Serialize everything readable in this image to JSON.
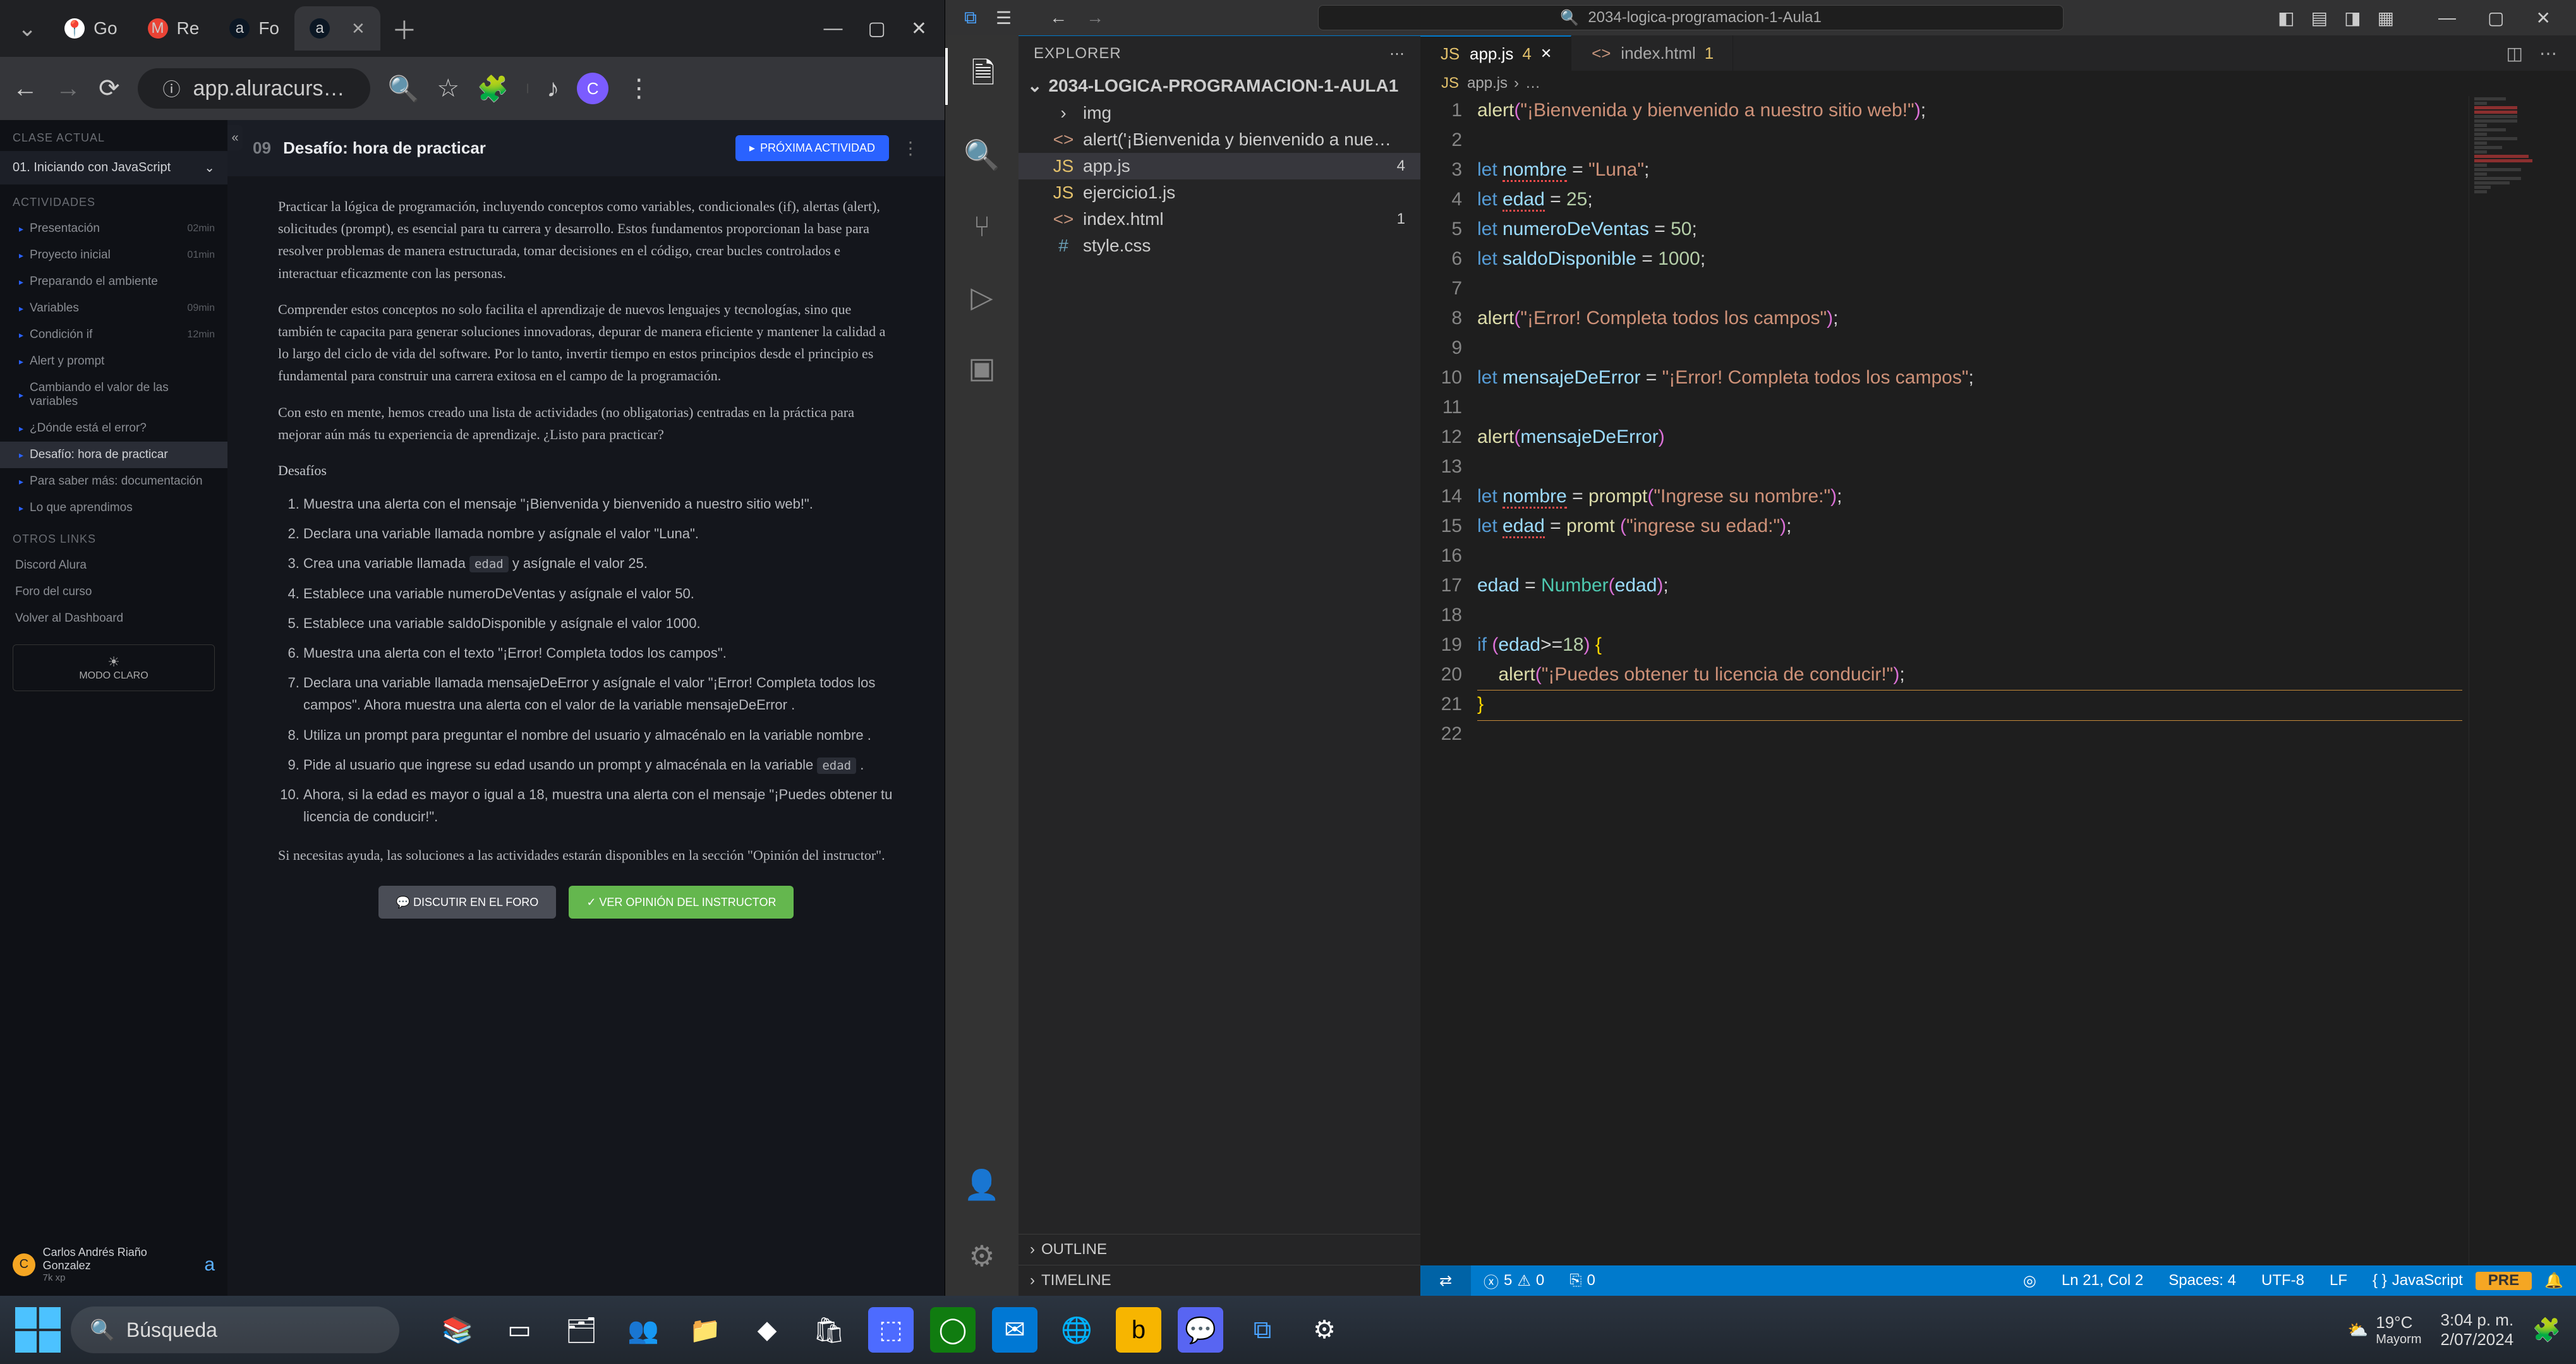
{
  "chrome": {
    "tabs": [
      {
        "label": "Go",
        "favicon": "📍",
        "fav_bg": "#fff"
      },
      {
        "label": "Re",
        "favicon": "M",
        "fav_bg": "#ea4335"
      },
      {
        "label": "Fo",
        "favicon": "a",
        "fav_bg": "#0b1724"
      },
      {
        "label": "",
        "favicon": "a",
        "fav_bg": "#0b1724",
        "active": true
      }
    ],
    "url": "app.aluracurs…"
  },
  "alura": {
    "section_class": "CLASE ACTUAL",
    "module": "01. Iniciando con JavaScript",
    "section_activities": "ACTIVIDADES",
    "items": [
      {
        "label": "Presentación",
        "dur": "02min"
      },
      {
        "label": "Proyecto inicial",
        "dur": "01min"
      },
      {
        "label": "Preparando el ambiente",
        "dur": ""
      },
      {
        "label": "Variables",
        "dur": "09min"
      },
      {
        "label": "Condición if",
        "dur": "12min"
      },
      {
        "label": "Alert y prompt",
        "dur": ""
      },
      {
        "label": "Cambiando el valor de las variables",
        "dur": ""
      },
      {
        "label": "¿Dónde está el error?",
        "dur": ""
      },
      {
        "label": "Desafío: hora de practicar",
        "dur": "",
        "active": true
      },
      {
        "label": "Para saber más: documentación",
        "dur": ""
      },
      {
        "label": "Lo que aprendimos",
        "dur": ""
      }
    ],
    "section_links": "OTROS LINKS",
    "links": [
      "Discord Alura",
      "Foro del curso",
      "Volver al Dashboard"
    ],
    "modo": "MODO CLARO",
    "user": {
      "name": "Carlos Andrés Riaño Gonzalez",
      "xp": "7k xp",
      "initial": "C"
    },
    "header": {
      "num": "09",
      "title": "Desafío: hora de practicar",
      "next": "PRÓXIMA ACTIVIDAD"
    },
    "paras": [
      "Practicar la lógica de programación, incluyendo conceptos como variables, condicionales (if), alertas (alert), solicitudes (prompt), es esencial para tu carrera y desarrollo. Estos fundamentos proporcionan la base para resolver problemas de manera estructurada, tomar decisiones en el código, crear bucles controlados e interactuar eficazmente con las personas.",
      "Comprender estos conceptos no solo facilita el aprendizaje de nuevos lenguajes y tecnologías, sino que también te capacita para generar soluciones innovadoras, depurar de manera eficiente y mantener la calidad a lo largo del ciclo de vida del software. Por lo tanto, invertir tiempo en estos principios desde el principio es fundamental para construir una carrera exitosa en el campo de la programación.",
      "Con esto en mente, hemos creado una lista de actividades (no obligatorias) centradas en la práctica para mejorar aún más tu experiencia de aprendizaje. ¿Listo para practicar?"
    ],
    "subhead": "Desafíos",
    "tasks": [
      "Muestra una alerta con el mensaje \"¡Bienvenida y bienvenido a nuestro sitio web!\".",
      "Declara una variable llamada nombre y asígnale el valor \"Luna\".",
      "Crea una variable llamada |edad| y asígnale el valor 25.",
      "Establece una variable numeroDeVentas y asígnale el valor 50.",
      "Establece una variable saldoDisponible y asígnale el valor 1000.",
      "Muestra una alerta con el texto \"¡Error! Completa todos los campos\".",
      "Declara una variable llamada mensajeDeError y asígnale el valor \"¡Error! Completa todos los campos\". Ahora muestra una alerta con el valor de la variable mensajeDeError .",
      "Utiliza un prompt para preguntar el nombre del usuario y almacénalo en la variable nombre .",
      "Pide al usuario que ingrese su edad usando un prompt y almacénala en la variable |edad| .",
      "Ahora, si la edad es mayor o igual a 18, muestra una alerta con el mensaje \"¡Puedes obtener tu licencia de conducir!\"."
    ],
    "help": "Si necesitas ayuda, las soluciones a las actividades estarán disponibles en la sección \"Opinión del instructor\".",
    "btn_forum": "DISCUTIR EN EL FORO",
    "btn_opinion": "VER OPINIÓN DEL INSTRUCTOR"
  },
  "vscode": {
    "project": "2034-logica-programacion-1-Aula1",
    "explorer_label": "EXPLORER",
    "folder": "2034-LOGICA-PROGRAMACION-1-AULA1",
    "tree": [
      {
        "icon": "›",
        "type": "folder",
        "name": "img"
      },
      {
        "icon": "<>",
        "type": "html",
        "name": "alert('¡Bienvenida y bienvenido a nue…"
      },
      {
        "icon": "JS",
        "type": "js",
        "name": "app.js",
        "badge": "4",
        "active": true
      },
      {
        "icon": "JS",
        "type": "js",
        "name": "ejercicio1.js"
      },
      {
        "icon": "<>",
        "type": "html",
        "name": "index.html",
        "badge": "1"
      },
      {
        "icon": "#",
        "type": "css",
        "name": "style.css"
      }
    ],
    "outline": "OUTLINE",
    "timeline": "TIMELINE",
    "tabs": [
      {
        "icon": "JS",
        "name": "app.js",
        "mod": "4",
        "active": true,
        "closable": true
      },
      {
        "icon": "<>",
        "name": "index.html",
        "mod": "1"
      }
    ],
    "breadcrumb": [
      "JS",
      "app.js",
      "›",
      "…"
    ],
    "code": [
      [
        [
          "fn",
          "alert"
        ],
        [
          "paren",
          "("
        ],
        [
          "str",
          "\"¡Bienvenida y bienvenido a nuestro sitio web!\""
        ],
        [
          "paren",
          ")"
        ],
        [
          "op",
          ";"
        ]
      ],
      [],
      [
        [
          "kw",
          "let"
        ],
        [
          "sp",
          " "
        ],
        [
          "var",
          "nombre",
          true
        ],
        [
          "sp",
          " "
        ],
        [
          "op",
          "="
        ],
        [
          "sp",
          " "
        ],
        [
          "str",
          "\"Luna\""
        ],
        [
          "op",
          ";"
        ]
      ],
      [
        [
          "kw",
          "let"
        ],
        [
          "sp",
          " "
        ],
        [
          "var",
          "edad",
          true
        ],
        [
          "sp",
          " "
        ],
        [
          "op",
          "="
        ],
        [
          "sp",
          " "
        ],
        [
          "num",
          "25"
        ],
        [
          "op",
          ";"
        ]
      ],
      [
        [
          "kw",
          "let"
        ],
        [
          "sp",
          " "
        ],
        [
          "var",
          "numeroDeVentas"
        ],
        [
          "sp",
          " "
        ],
        [
          "op",
          "="
        ],
        [
          "sp",
          " "
        ],
        [
          "num",
          "50"
        ],
        [
          "op",
          ";"
        ]
      ],
      [
        [
          "kw",
          "let"
        ],
        [
          "sp",
          " "
        ],
        [
          "var",
          "saldoDisponible"
        ],
        [
          "sp",
          " "
        ],
        [
          "op",
          "="
        ],
        [
          "sp",
          " "
        ],
        [
          "num",
          "1000"
        ],
        [
          "op",
          ";"
        ]
      ],
      [],
      [
        [
          "fn",
          "alert"
        ],
        [
          "paren",
          "("
        ],
        [
          "str",
          "\"¡Error! Completa todos los campos\""
        ],
        [
          "paren",
          ")"
        ],
        [
          "op",
          ";"
        ]
      ],
      [],
      [
        [
          "kw",
          "let"
        ],
        [
          "sp",
          " "
        ],
        [
          "var",
          "mensajeDeError"
        ],
        [
          "sp",
          " "
        ],
        [
          "op",
          "="
        ],
        [
          "sp",
          " "
        ],
        [
          "str",
          "\"¡Error! Completa todos los campos\""
        ],
        [
          "op",
          ";"
        ]
      ],
      [],
      [
        [
          "fn",
          "alert"
        ],
        [
          "paren",
          "("
        ],
        [
          "var",
          "mensajeDeError"
        ],
        [
          "paren",
          ")"
        ]
      ],
      [],
      [
        [
          "kw",
          "let"
        ],
        [
          "sp",
          " "
        ],
        [
          "var",
          "nombre",
          true
        ],
        [
          "sp",
          " "
        ],
        [
          "op",
          "="
        ],
        [
          "sp",
          " "
        ],
        [
          "fn",
          "prompt"
        ],
        [
          "paren",
          "("
        ],
        [
          "str",
          "\"Ingrese su nombre:\""
        ],
        [
          "paren",
          ")"
        ],
        [
          "op",
          ";"
        ]
      ],
      [
        [
          "kw",
          "let"
        ],
        [
          "sp",
          " "
        ],
        [
          "var",
          "edad",
          true
        ],
        [
          "sp",
          " "
        ],
        [
          "op",
          "="
        ],
        [
          "sp",
          " "
        ],
        [
          "fn",
          "promt"
        ],
        [
          "sp",
          " "
        ],
        [
          "paren",
          "("
        ],
        [
          "str",
          "\"ingrese su edad:\""
        ],
        [
          "paren",
          ")"
        ],
        [
          "op",
          ";"
        ]
      ],
      [],
      [
        [
          "var",
          "edad"
        ],
        [
          "sp",
          " "
        ],
        [
          "op",
          "="
        ],
        [
          "sp",
          " "
        ],
        [
          "type",
          "Number"
        ],
        [
          "paren",
          "("
        ],
        [
          "var",
          "edad"
        ],
        [
          "paren",
          ")"
        ],
        [
          "op",
          ";"
        ]
      ],
      [],
      [
        [
          "kw",
          "if"
        ],
        [
          "sp",
          " "
        ],
        [
          "paren",
          "("
        ],
        [
          "var",
          "edad"
        ],
        [
          "op",
          ">="
        ],
        [
          "num",
          "18"
        ],
        [
          "paren",
          ")"
        ],
        [
          "sp",
          " "
        ],
        [
          "brace",
          "{"
        ]
      ],
      [
        [
          "sp",
          "    "
        ],
        [
          "fn",
          "alert"
        ],
        [
          "paren",
          "("
        ],
        [
          "str",
          "\"¡Puedes obtener tu licencia de conducir!\""
        ],
        [
          "paren",
          ")"
        ],
        [
          "op",
          ";"
        ]
      ],
      [
        [
          "brace",
          "}"
        ]
      ],
      []
    ],
    "status": {
      "errors": "5",
      "warnings": "0",
      "ports": "0",
      "ln": "Ln 21, Col 2",
      "spaces": "Spaces: 4",
      "enc": "UTF-8",
      "eol": "LF",
      "lang": "JavaScript"
    }
  },
  "taskbar": {
    "search_placeholder": "Búsqueda",
    "weather": {
      "temp": "19°C",
      "cond": "Mayorm"
    },
    "time": "3:04 p. m.",
    "date": "2/07/2024"
  }
}
